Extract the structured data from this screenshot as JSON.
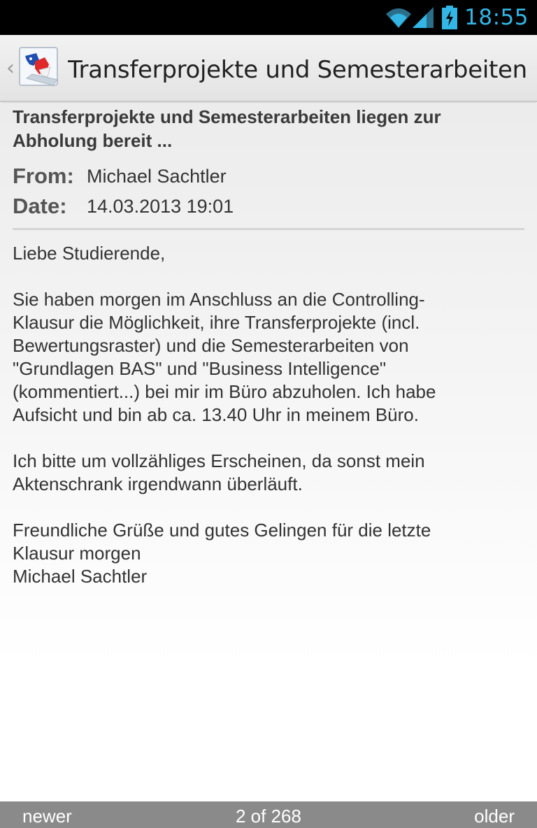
{
  "status_bar": {
    "time": "18:55",
    "icons": [
      "wifi-icon",
      "signal-icon",
      "battery-charging-icon"
    ],
    "accent_color": "#33b5e5"
  },
  "action_bar": {
    "title": "Transferprojekte und Semesterarbeiten…",
    "up_icon": "chevron-left-icon",
    "app_icon": "app-logo-icon"
  },
  "message": {
    "subject_lines": [
      "Transferprojekte und Semesterarbeiten liegen zur",
      "Abholung bereit ..."
    ],
    "from_label": "From:",
    "from_value": "Michael Sachtler",
    "date_label": "Date:",
    "date_value": "14.03.2013 19:01",
    "greeting": "Liebe Studierende,",
    "paragraph1": [
      "Sie haben morgen im Anschluss an die Controlling-",
      "Klausur die Möglichkeit, ihre Transferprojekte (incl.",
      "Bewertungsraster) und die Semesterarbeiten von",
      "\"Grundlagen BAS\" und \"Business Intelligence\"",
      "(kommentiert...) bei mir im Büro abzuholen. Ich habe",
      "Aufsicht und bin ab ca. 13.40 Uhr in meinem Büro."
    ],
    "paragraph2": [
      "Ich bitte um vollzähliges Erscheinen, da sonst mein",
      "Aktenschrank irgendwann überläuft."
    ],
    "closing": [
      "Freundliche Grüße und gutes Gelingen für die letzte",
      "Klausur morgen",
      "Michael Sachtler"
    ]
  },
  "bottom_bar": {
    "newer_label": "newer",
    "position_label": "2 of 268",
    "older_label": "older"
  }
}
